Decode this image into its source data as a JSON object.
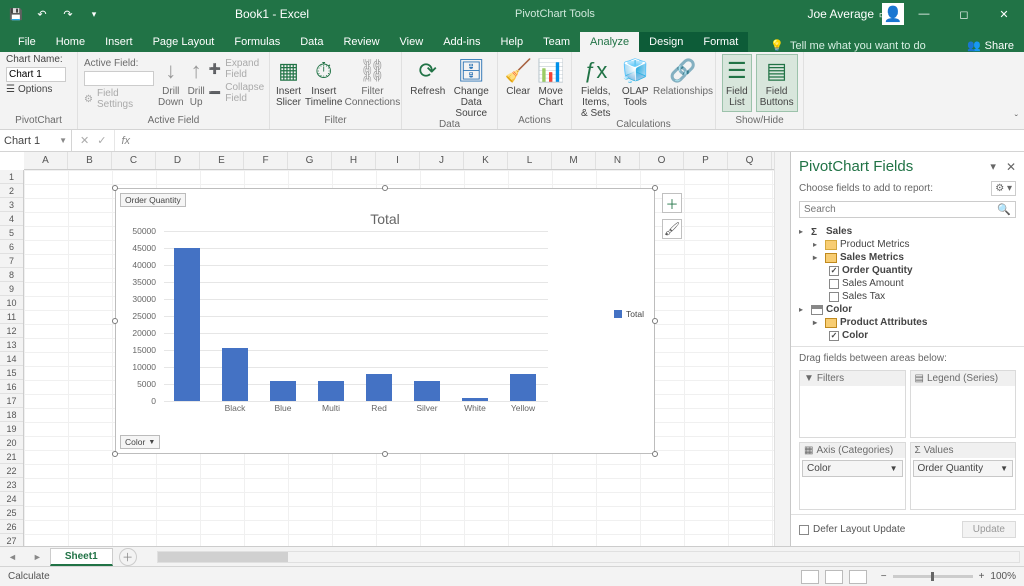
{
  "title": "Book1 - Excel",
  "context_tools": "PivotChart Tools",
  "user": "Joe Average",
  "menubar": [
    "File",
    "Home",
    "Insert",
    "Page Layout",
    "Formulas",
    "Data",
    "Review",
    "View",
    "Add-ins",
    "Help",
    "Team",
    "Analyze",
    "Design",
    "Format"
  ],
  "menubar_active": "Analyze",
  "tellme": "Tell me what you want to do",
  "share": "Share",
  "ribbon": {
    "pivotchart": {
      "label": "PivotChart",
      "chart_name_label": "Chart Name:",
      "chart_name": "Chart 1",
      "options": "Options"
    },
    "activefield": {
      "label": "Active Field",
      "field_label": "Active Field:",
      "drilldown": "Drill Down",
      "drillup": "Drill Up",
      "expand": "Expand Field",
      "collapse": "Collapse Field",
      "settings": "Field Settings"
    },
    "filter": {
      "label": "Filter",
      "slicer": "Insert Slicer",
      "timeline": "Insert Timeline",
      "connections": "Filter Connections"
    },
    "data": {
      "label": "Data",
      "refresh": "Refresh",
      "changesrc": "Change Data Source"
    },
    "actions": {
      "label": "Actions",
      "clear": "Clear",
      "move": "Move Chart"
    },
    "calculations": {
      "label": "Calculations",
      "fields": "Fields, Items, & Sets",
      "olap": "OLAP Tools",
      "relationships": "Relationships"
    },
    "showhide": {
      "label": "Show/Hide",
      "fieldlist": "Field List",
      "fieldbuttons": "Field Buttons"
    }
  },
  "namebox": "Chart 1",
  "chart_data": {
    "type": "bar",
    "title": "Total",
    "pivot_value_button": "Order Quantity",
    "pivot_axis_button": "Color",
    "legend": "Total",
    "ylim": [
      0,
      50000
    ],
    "yticks": [
      0,
      5000,
      10000,
      15000,
      20000,
      25000,
      30000,
      35000,
      40000,
      45000,
      50000
    ],
    "categories": [
      "",
      "Black",
      "Blue",
      "Multi",
      "Red",
      "Silver",
      "White",
      "Yellow"
    ],
    "values": [
      45000,
      15500,
      6000,
      6000,
      7800,
      5800,
      1000,
      7800
    ]
  },
  "columns": [
    "A",
    "B",
    "C",
    "D",
    "E",
    "F",
    "G",
    "H",
    "I",
    "J",
    "K",
    "L",
    "M",
    "N",
    "O",
    "P",
    "Q"
  ],
  "row_count": 28,
  "taskpane": {
    "title": "PivotChart Fields",
    "sub": "Choose fields to add to report:",
    "search_placeholder": "Search",
    "tree": {
      "sales": "Sales",
      "product_metrics": "Product Metrics",
      "sales_metrics": "Sales Metrics",
      "order_qty": "Order Quantity",
      "sales_amount": "Sales Amount",
      "sales_tax": "Sales Tax",
      "color_table": "Color",
      "product_attributes": "Product Attributes",
      "color_field": "Color"
    },
    "drag_hint": "Drag fields between areas below:",
    "areas": {
      "filters": "Filters",
      "legend": "Legend (Series)",
      "axis": "Axis (Categories)",
      "values": "Values"
    },
    "axis_field": "Color",
    "values_field": "Order Quantity",
    "defer": "Defer Layout Update",
    "update": "Update"
  },
  "sheet": "Sheet1",
  "status": "Calculate",
  "zoom": "100%"
}
